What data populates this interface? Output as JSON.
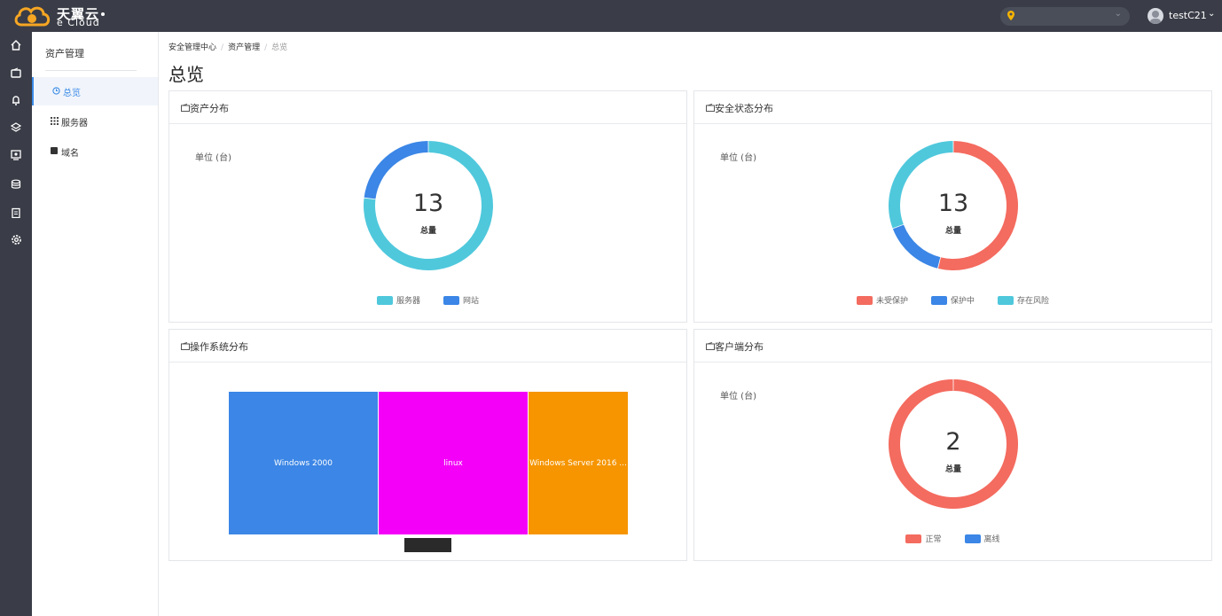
{
  "header": {
    "logo_text": "天翼云",
    "logo_sub": "e Cloud",
    "region_value": "",
    "user_name": "testC21"
  },
  "rail": {
    "icons": [
      "home-icon",
      "wallet-icon",
      "bell-icon",
      "layers-icon",
      "monitor-icon",
      "database-icon",
      "clipboard-icon",
      "settings-icon"
    ]
  },
  "subnav": {
    "title": "资产管理",
    "items": [
      {
        "label": "总览",
        "icon": "clock-icon",
        "active": true
      },
      {
        "label": "服务器",
        "icon": "grid-icon",
        "active": false
      },
      {
        "label": "域名",
        "icon": "cube-icon",
        "active": false
      }
    ]
  },
  "breadcrumb": [
    "安全管理中心",
    "资产管理",
    "总览"
  ],
  "page_title": "总览",
  "colors": {
    "cyan": "#4fc8dc",
    "blue": "#3b86e6",
    "red": "#f46b5f",
    "magenta": "#f400f8",
    "orange": "#f69500"
  },
  "cards": {
    "assets": {
      "title": "资产分布",
      "unit": "单位 (台)",
      "total": "13",
      "total_label": "总量",
      "legend": [
        "服务器",
        "网站"
      ]
    },
    "security": {
      "title": "安全状态分布",
      "unit": "单位 (台)",
      "total": "13",
      "total_label": "总量",
      "legend": [
        "未受保护",
        "保护中",
        "存在风险"
      ]
    },
    "os": {
      "title": "操作系统分布"
    },
    "client": {
      "title": "客户端分布",
      "unit": "单位 (台)",
      "total": "2",
      "total_label": "总量",
      "legend": [
        "正常",
        "离线"
      ]
    }
  },
  "chart_data": [
    {
      "type": "pie",
      "title": "资产分布",
      "labels": [
        "服务器",
        "网站"
      ],
      "values": [
        10,
        3
      ],
      "colors": [
        "#4fc8dc",
        "#3b86e6"
      ]
    },
    {
      "type": "pie",
      "title": "安全状态分布",
      "labels": [
        "未受保护",
        "保护中",
        "存在风险"
      ],
      "values": [
        7,
        2,
        4
      ],
      "colors": [
        "#f46b5f",
        "#3b86e6",
        "#4fc8dc"
      ]
    },
    {
      "type": "treemap",
      "title": "操作系统分布",
      "labels": [
        "Windows 2000",
        "linux",
        "Windows Server 2016 ..."
      ],
      "values": [
        3,
        3,
        2
      ],
      "colors": [
        "#3b86e6",
        "#f400f8",
        "#f69500"
      ]
    },
    {
      "type": "pie",
      "title": "客户端分布",
      "labels": [
        "正常",
        "离线"
      ],
      "values": [
        2,
        0
      ],
      "colors": [
        "#f46b5f",
        "#3b86e6"
      ]
    }
  ]
}
